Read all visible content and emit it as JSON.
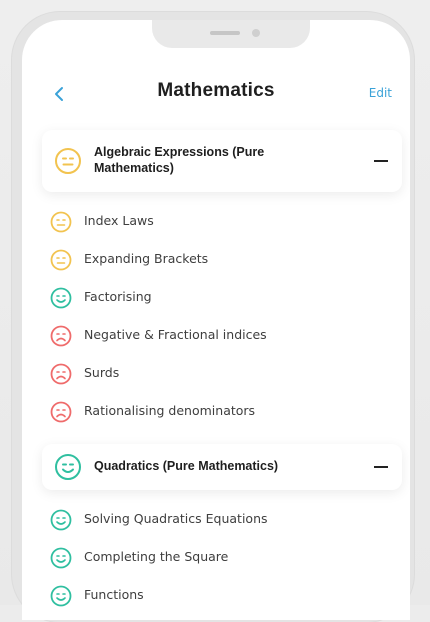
{
  "header": {
    "title": "Mathematics",
    "edit_label": "Edit"
  },
  "colors": {
    "neutral": "#f2c34f",
    "good": "#2fbfa0",
    "bad": "#ef6b6b",
    "accent": "#3aa2d8"
  },
  "sections": [
    {
      "title": "Algebraic Expressions (Pure Mathematics)",
      "title_line1": "Algebraic Expressions (Pure",
      "title_line2": "Mathematics)",
      "status": "neutral",
      "items": [
        {
          "label": "Index Laws",
          "status": "neutral"
        },
        {
          "label": "Expanding Brackets",
          "status": "neutral"
        },
        {
          "label": "Factorising",
          "status": "good"
        },
        {
          "label": "Negative & Fractional indices",
          "status": "bad"
        },
        {
          "label": "Surds",
          "status": "bad"
        },
        {
          "label": "Rationalising denominators",
          "status": "bad"
        }
      ]
    },
    {
      "title": "Quadratics (Pure Mathematics)",
      "status": "good",
      "items": [
        {
          "label": "Solving Quadratics Equations",
          "status": "good"
        },
        {
          "label": "Completing the Square",
          "status": "good"
        },
        {
          "label": "Functions",
          "status": "good"
        }
      ]
    }
  ]
}
